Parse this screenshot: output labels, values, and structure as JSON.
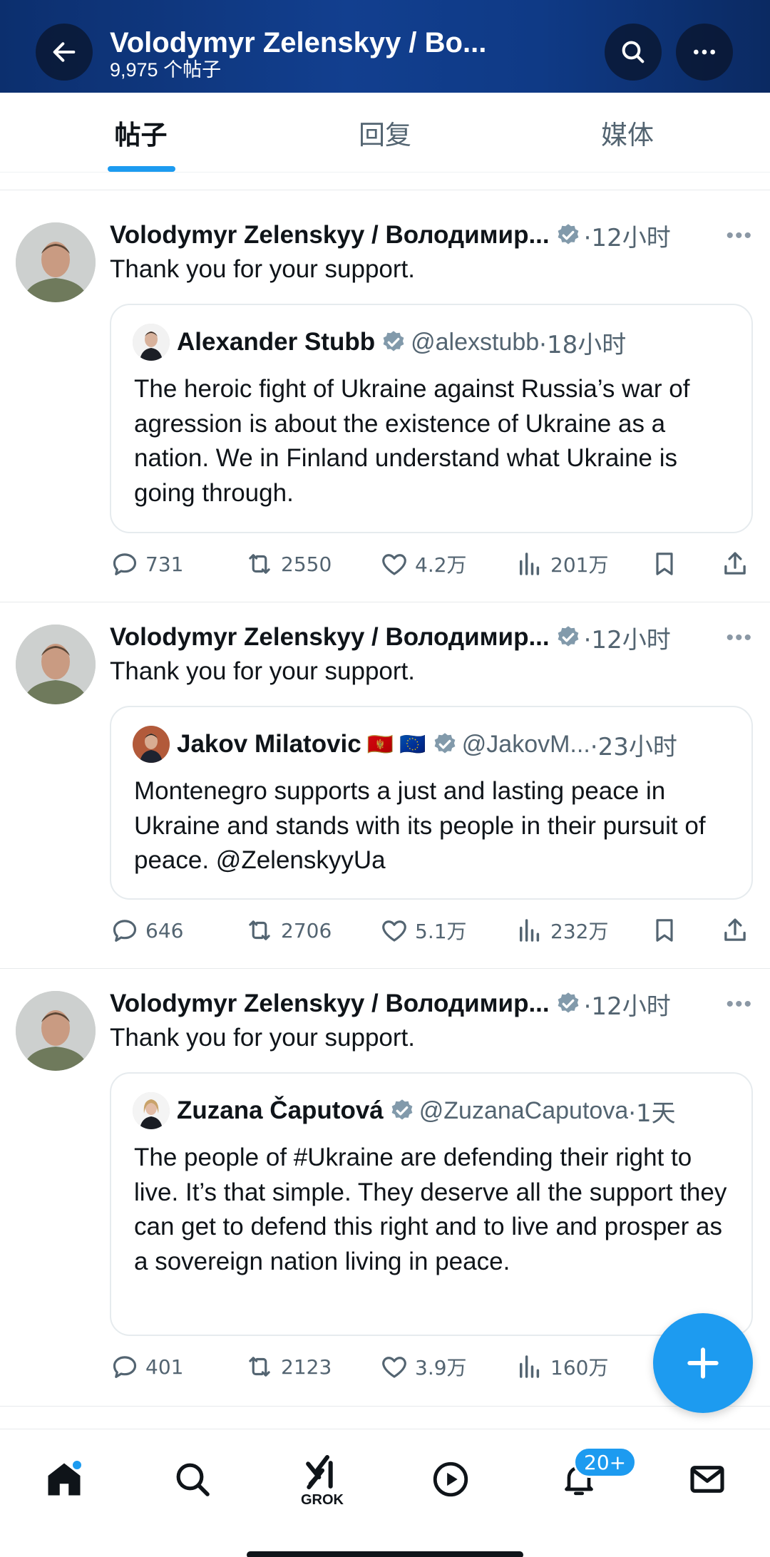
{
  "header": {
    "title": "Volodymyr Zelenskyy / Bo...",
    "subtitle": "9,975 个帖子"
  },
  "tabs": [
    {
      "label": "帖子",
      "active": true
    },
    {
      "label": "回复",
      "active": false
    },
    {
      "label": "媒体",
      "active": false
    }
  ],
  "tweets": [
    {
      "author": "Volodymyr Zelenskyy / Володимир...",
      "time": "·12小时",
      "text": "Thank you for your support.",
      "quote": {
        "name": "Alexander Stubb",
        "handle": "@alexstubb",
        "time": "·18小时",
        "flags": "",
        "text": "The heroic fight of Ukraine against Russia’s war of agression is about the existence of Ukraine as a nation. We in Finland understand what Ukraine is going through."
      },
      "stats": {
        "replies": "731",
        "reposts": "2550",
        "likes": "4.2万",
        "views": "201万"
      }
    },
    {
      "author": "Volodymyr Zelenskyy / Володимир...",
      "time": "·12小时",
      "text": "Thank you for your support.",
      "quote": {
        "name": "Jakov Milatovic",
        "handle": "@JakovM...",
        "time": "·23小时",
        "flags": "🇲🇪 🇪🇺",
        "text": "Montenegro supports a just and lasting peace in Ukraine and stands with its people in their pursuit of peace. @ZelenskyyUa"
      },
      "stats": {
        "replies": "646",
        "reposts": "2706",
        "likes": "5.1万",
        "views": "232万"
      }
    },
    {
      "author": "Volodymyr Zelenskyy / Володимир...",
      "time": "·12小时",
      "text": "Thank you for your support.",
      "quote": {
        "name": "Zuzana Čaputová",
        "handle": "@ZuzanaCaputova",
        "time": "·1天",
        "flags": "",
        "text": "The people of #Ukraine are defending their right to live. It’s that simple. They deserve all the support they can get to defend this right and to live and prosper as a sovereign nation living in peace."
      },
      "stats": {
        "replies": "401",
        "reposts": "2123",
        "likes": "3.9万",
        "views": "160万"
      }
    }
  ],
  "bottom_nav": {
    "grok_label": "GROK",
    "notifications_badge": "20+",
    "items": [
      "home-icon",
      "search-icon",
      "grok-icon",
      "video-icon",
      "bell-icon",
      "mail-icon"
    ]
  },
  "colors": {
    "accent": "#1d9bf0",
    "header_bg": "#123f8f",
    "text": "#0f1419",
    "muted": "#536471"
  }
}
